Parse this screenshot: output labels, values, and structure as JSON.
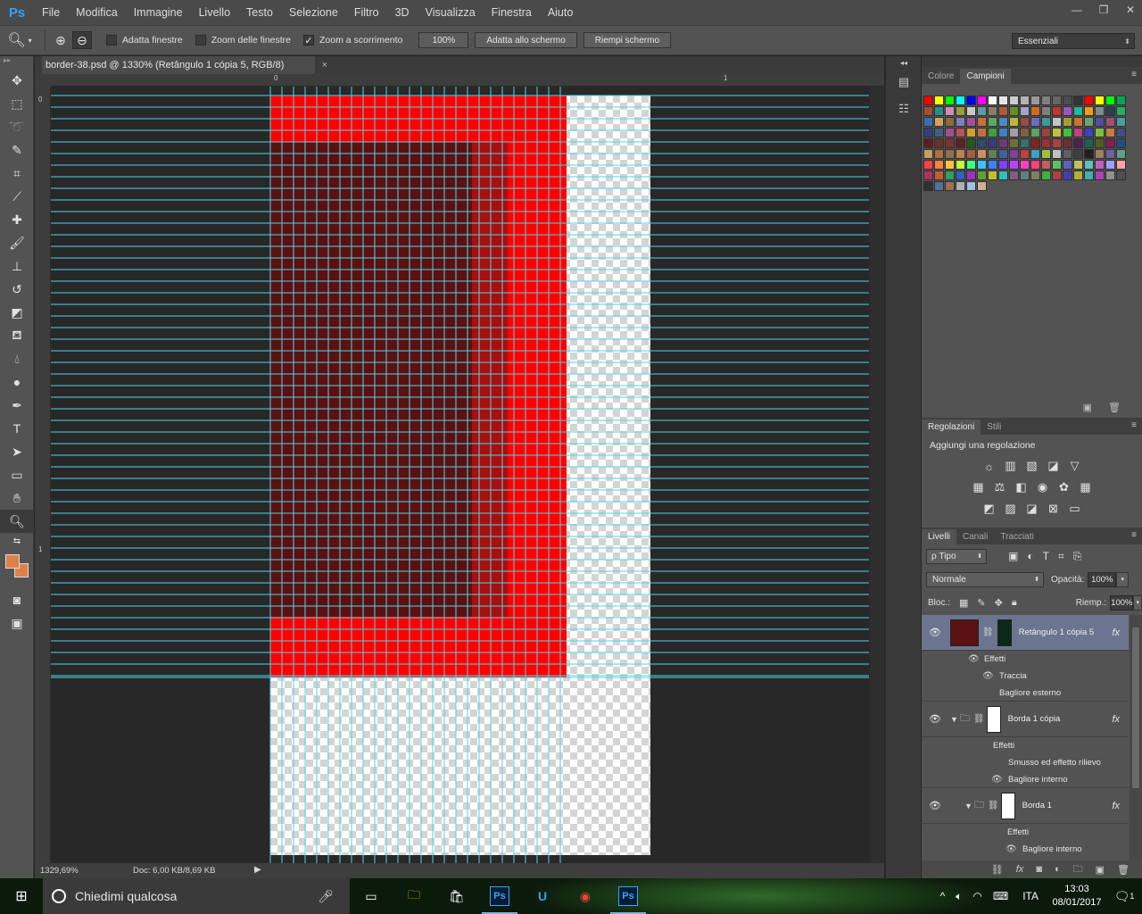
{
  "menubar": {
    "logo": "Ps",
    "items": [
      "File",
      "Modifica",
      "Immagine",
      "Livello",
      "Testo",
      "Selezione",
      "Filtro",
      "3D",
      "Visualizza",
      "Finestra",
      "Aiuto"
    ],
    "window_controls": [
      "minimize-icon",
      "restore-icon",
      "close-icon"
    ]
  },
  "options": {
    "tool_icon": "zoom-icon",
    "zoom_in_icon": "zoom-in-icon",
    "zoom_out_icon": "zoom-out-icon",
    "checks": [
      {
        "label": "Adatta finestre",
        "checked": false
      },
      {
        "label": "Zoom delle finestre",
        "checked": false
      },
      {
        "label": "Zoom a scorrimento",
        "checked": true
      }
    ],
    "zoom_field": "100%",
    "buttons": [
      "Adatta allo schermo",
      "Riempi schermo"
    ],
    "workspace": "Essenziali"
  },
  "document": {
    "tab_title": "border-38.psd @ 1330% (Retângulo 1 cópia 5, RGB/8)",
    "close": "×",
    "ruler_h_labels": [
      "0",
      "1"
    ],
    "ruler_v_labels": [
      "0",
      "1"
    ],
    "colors": {
      "bright_red": "#ff0000",
      "dark_red": "#5b1111",
      "mid_red": "#a80f0f",
      "guide": "#4fd6e6",
      "transparent_a": "#ffffff",
      "transparent_b": "#d4d4d4"
    }
  },
  "status": {
    "zoom": "1329,69%",
    "doc": "Doc: 6,00 KB/8,69 KB"
  },
  "toolbox": {
    "tools": [
      "move-icon",
      "marquee-icon",
      "lasso-icon",
      "quick-select-icon",
      "crop-icon",
      "eyedropper-icon",
      "healing-icon",
      "brush-icon",
      "stamp-icon",
      "history-brush-icon",
      "eraser-icon",
      "bucket-icon",
      "blur-icon",
      "dodge-icon",
      "pen-icon",
      "type-icon",
      "path-select-icon",
      "shape-icon",
      "hand-icon",
      "zoom-icon"
    ],
    "fg_color": "#e08049",
    "bg_color": "#e08049"
  },
  "swatches_panel": {
    "tabs": [
      "Colore",
      "Campioni"
    ],
    "active_tab": "Campioni",
    "colors": [
      "#ff0000",
      "#ffff00",
      "#00ff00",
      "#00ffff",
      "#0000ff",
      "#ff00ff",
      "#ffffff",
      "#e6e6e6",
      "#cccccc",
      "#b3b3b3",
      "#999999",
      "#808080",
      "#666666",
      "#4d4d4d",
      "#333333",
      "#ff0000",
      "#ffff00",
      "#00ff00",
      "#00a651",
      "#a0522d",
      "#2b8a8a",
      "#d18cbd",
      "#9c9c38",
      "#c8c8c8",
      "#5f9ea0",
      "#8b7d6b",
      "#b05c3a",
      "#6b8e23",
      "#a3a3d6",
      "#d2691e",
      "#808080",
      "#c0392b",
      "#9b59b6",
      "#1abc9c",
      "#f39c12",
      "#7f8c8d",
      "#2c3e50",
      "#27ae60",
      "#3c6db2",
      "#d1a05a",
      "#8e6b3c",
      "#7f7fbf",
      "#a84f9b",
      "#c96e3d",
      "#5fa85f",
      "#4e89c7",
      "#b8b83b",
      "#9a4d3c",
      "#6d6dbf",
      "#3d9a9a",
      "#c4c4c4",
      "#a0a030",
      "#d07030",
      "#6fa06f",
      "#5050a0",
      "#a05070",
      "#40a0a0",
      "#304080",
      "#406080",
      "#a05090",
      "#c05050",
      "#d0a030",
      "#c07040",
      "#40a040",
      "#4080c0",
      "#a0a0a0",
      "#806040",
      "#60a060",
      "#a04040",
      "#c0c040",
      "#40c040",
      "#c04080",
      "#4040c0",
      "#80c040",
      "#c08040",
      "#405080",
      "#5a2020",
      "#6b3030",
      "#803030",
      "#602020",
      "#205a20",
      "#304a70",
      "#3a3a80",
      "#703a70",
      "#70703a",
      "#3a7070",
      "#8a2020",
      "#a03030",
      "#b04040",
      "#703030",
      "#502050",
      "#206050",
      "#506020",
      "#802050",
      "#205080",
      "#c0a060",
      "#b07040",
      "#907050",
      "#c08050",
      "#a06040",
      "#d09060",
      "#608060",
      "#4060a0",
      "#8040a0",
      "#c04040",
      "#40a0c0",
      "#a0c040",
      "#c0c0c0",
      "#606060",
      "#404040",
      "#202020",
      "#a08060",
      "#7060a0",
      "#60a080",
      "#ff4040",
      "#ff8040",
      "#ffc040",
      "#c0ff40",
      "#40ff80",
      "#40c0ff",
      "#4080ff",
      "#8040ff",
      "#c040ff",
      "#ff40c0",
      "#ff4080",
      "#c06060",
      "#60c060",
      "#6060c0",
      "#c0c060",
      "#60c0c0",
      "#c060c0",
      "#a0a0ff",
      "#ffa0a0",
      "#b03060",
      "#c06030",
      "#30a060",
      "#3060c0",
      "#a030c0",
      "#60a030",
      "#c0c030",
      "#30c0c0",
      "#806080",
      "#608080",
      "#808060",
      "#40b040",
      "#b04040",
      "#4040b0",
      "#b0b040",
      "#40b0b0",
      "#b040b0",
      "#909090",
      "#505050",
      "#303030",
      "#5070a0",
      "#a07050",
      "#b0b0b0",
      "#a0c0e0",
      "#d0b090"
    ]
  },
  "adjust_panel": {
    "tabs": [
      "Regolazioni",
      "Stili"
    ],
    "active_tab": "Regolazioni",
    "title": "Aggiungi una regolazione",
    "row1": [
      "brightness-icon",
      "levels-icon",
      "curves-icon",
      "exposure-icon",
      "vibrance-icon"
    ],
    "row2": [
      "hue-icon",
      "color-balance-icon",
      "bw-icon",
      "photo-filter-icon",
      "channel-mixer-icon",
      "lookup-icon"
    ],
    "row3": [
      "invert-icon",
      "posterize-icon",
      "threshold-icon",
      "selective-color-icon",
      "gradient-map-icon"
    ]
  },
  "layers_panel": {
    "tabs": [
      "Livelli",
      "Canali",
      "Tracciati"
    ],
    "active_tab": "Livelli",
    "filter": "ρ Tipo",
    "blend_mode": "Normale",
    "opacity_label": "Opacità:",
    "opacity": "100%",
    "lock_label": "Bloc.:",
    "fill_label": "Riemp.:",
    "fill": "100%",
    "layers": [
      {
        "name": "Retângulo 1 cópia 5",
        "selected": true,
        "thumb_color": "#5b1111",
        "effects_label": "Effetti",
        "effects": [
          "Traccia",
          "Bagliore esterno"
        ]
      },
      {
        "name": "Borda 1 cópia",
        "selected": false,
        "thumb_color": "#ffffff",
        "effects_label": "Effetti",
        "effects": [
          "Smusso ed effetto rilievo",
          "Bagliore interno"
        ]
      },
      {
        "name": "Borda 1",
        "selected": false,
        "thumb_color": "#ffffff",
        "effects_label": "Effetti",
        "effects": [
          "Bagliore interno"
        ]
      }
    ]
  },
  "taskbar": {
    "search_placeholder": "Chiedimi qualcosa",
    "language": "ITA",
    "time": "13:03",
    "date": "08/01/2017",
    "notifications": "1"
  }
}
